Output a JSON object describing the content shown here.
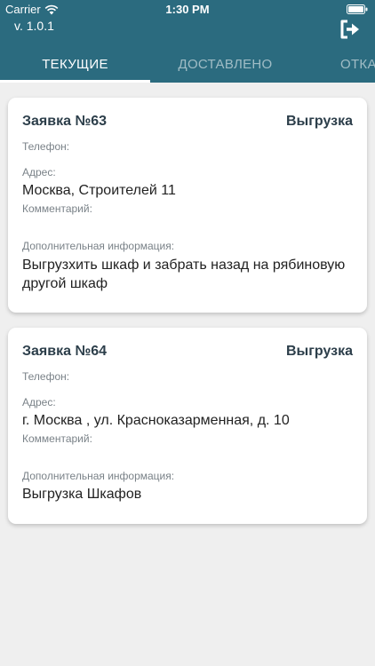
{
  "status_bar": {
    "carrier": "Carrier",
    "time": "1:30 PM"
  },
  "header": {
    "version": "v. 1.0.1",
    "logout_icon": "logout-icon"
  },
  "tabs": [
    {
      "label": "ТЕКУЩИЕ",
      "active": true
    },
    {
      "label": "ДОСТАВЛЕНО",
      "active": false
    },
    {
      "label": "ОТКА",
      "active": false
    }
  ],
  "orders": [
    {
      "title": "Заявка №63",
      "type": "Выгрузка",
      "phone_label": "Телефон:",
      "address_label": "Адрес:",
      "address": "Москва, Строителей 11",
      "comment_label": "Комментарий:",
      "extra_label": "Дополнительная информация:",
      "extra": "Выгрузхить шкаф и забрать назад на рябиновую другой шкаф"
    },
    {
      "title": "Заявка №64",
      "type": "Выгрузка",
      "phone_label": "Телефон:",
      "address_label": "Адрес:",
      "address": "г. Москва , ул. Красноказарменная, д. 10",
      "comment_label": "Комментарий:",
      "extra_label": "Дополнительная информация:",
      "extra": "Выгрузка Шкафов"
    }
  ],
  "colors": {
    "header": "#2b6b7f",
    "background": "#efefef",
    "card": "#ffffff"
  }
}
